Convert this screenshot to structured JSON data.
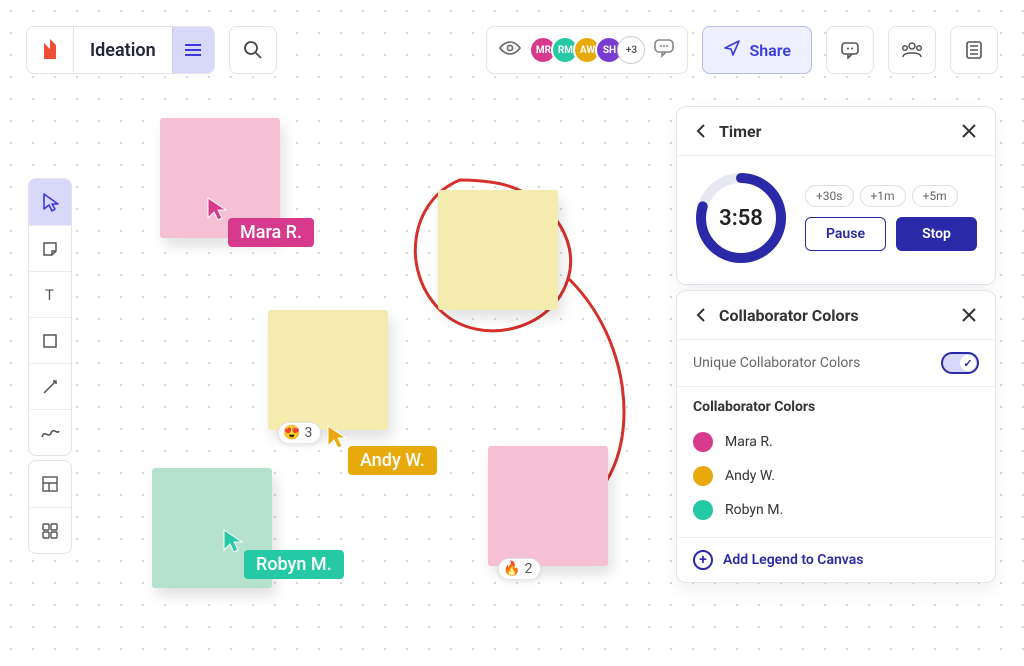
{
  "doc_title": "Ideation",
  "share_label": "Share",
  "avatars": [
    {
      "initials": "MR",
      "color": "#d73a8c"
    },
    {
      "initials": "RM",
      "color": "#25c9a3"
    },
    {
      "initials": "AW",
      "color": "#e8a90c"
    },
    {
      "initials": "SH",
      "color": "#7a3ccf"
    }
  ],
  "avatar_overflow": "+3",
  "notes": {
    "n1": {
      "emoji": "😍",
      "count": "3"
    },
    "n2": {
      "emoji": "🔥",
      "count": "2"
    }
  },
  "cursors": {
    "mara": {
      "label": "Mara R.",
      "color": "#d73a8c"
    },
    "andy": {
      "label": "Andy W.",
      "color": "#e8a90c"
    },
    "robyn": {
      "label": "Robyn M.",
      "color": "#25c9a3"
    }
  },
  "timer": {
    "title": "Timer",
    "value": "3:58",
    "chips": [
      "+30s",
      "+1m",
      "+5m"
    ],
    "pause": "Pause",
    "stop": "Stop",
    "progress_dash": "200 251"
  },
  "collab": {
    "title": "Collaborator Colors",
    "toggle_label": "Unique Collaborator Colors",
    "list_title": "Collaborator Colors",
    "items": [
      {
        "name": "Mara R.",
        "color": "#d73a8c"
      },
      {
        "name": "Andy W.",
        "color": "#e8a90c"
      },
      {
        "name": "Robyn M.",
        "color": "#25c9a3"
      }
    ],
    "footer": "Add Legend to Canvas"
  }
}
